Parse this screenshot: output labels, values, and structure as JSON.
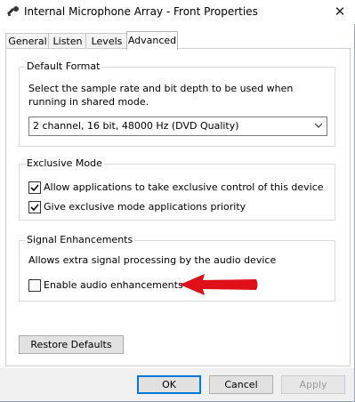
{
  "window": {
    "title": "Internal Microphone Array - Front Properties",
    "close_glyph": "✕"
  },
  "tabs": [
    {
      "label": "General"
    },
    {
      "label": "Listen"
    },
    {
      "label": "Levels"
    },
    {
      "label": "Advanced",
      "active": true
    }
  ],
  "default_format": {
    "legend": "Default Format",
    "description": "Select the sample rate and bit depth to be used when running in shared mode.",
    "selected": "2 channel, 16 bit, 48000 Hz (DVD Quality)"
  },
  "exclusive_mode": {
    "legend": "Exclusive Mode",
    "allow_label": "Allow applications to take exclusive control of this device",
    "allow_checked": true,
    "priority_label": "Give exclusive mode applications priority",
    "priority_checked": true
  },
  "signal_enhancements": {
    "legend": "Signal Enhancements",
    "description": "Allows extra signal processing by the audio device",
    "enable_label": "Enable audio enhancements",
    "enable_checked": false,
    "annotation": "red-arrow-pointing-left"
  },
  "buttons": {
    "restore_defaults": "Restore Defaults",
    "ok": "OK",
    "cancel": "Cancel",
    "apply": "Apply"
  },
  "colors": {
    "accent": "#0078d7",
    "arrow": "#e0101a"
  }
}
